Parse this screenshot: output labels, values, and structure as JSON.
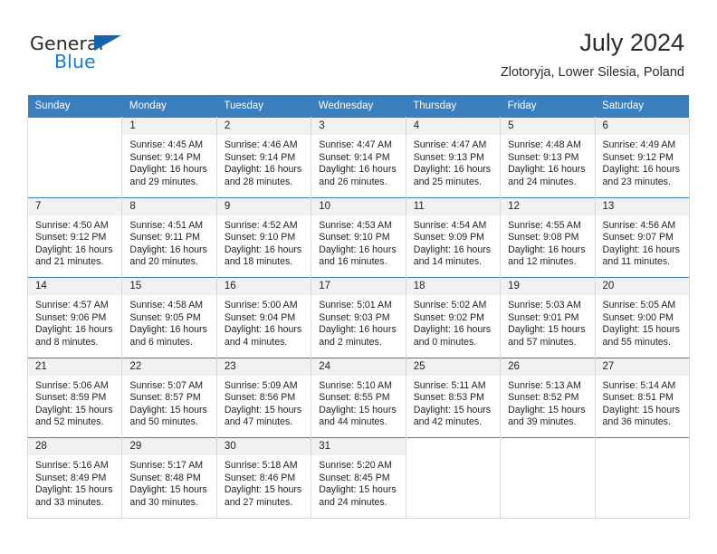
{
  "brand": {
    "name_dark": "General",
    "name_blue": "Blue",
    "accent_blue": "#1a7fd4",
    "triangle_blue": "#1464aa"
  },
  "header": {
    "title": "July 2024",
    "subtitle": "Zlotoryja, Lower Silesia, Poland"
  },
  "theme": {
    "header_row_bg": "#3a7ebe",
    "header_row_text": "#ffffff",
    "daynum_bg": "#f1f1f1",
    "cell_border": "#d8d8d8",
    "week_top_border": "#3a7ebe"
  },
  "weekdays": [
    "Sunday",
    "Monday",
    "Tuesday",
    "Wednesday",
    "Thursday",
    "Friday",
    "Saturday"
  ],
  "weeks": [
    [
      {
        "day": "",
        "sunrise": "",
        "sunset": "",
        "daylight1": "",
        "daylight2": ""
      },
      {
        "day": "1",
        "sunrise": "Sunrise: 4:45 AM",
        "sunset": "Sunset: 9:14 PM",
        "daylight1": "Daylight: 16 hours",
        "daylight2": "and 29 minutes."
      },
      {
        "day": "2",
        "sunrise": "Sunrise: 4:46 AM",
        "sunset": "Sunset: 9:14 PM",
        "daylight1": "Daylight: 16 hours",
        "daylight2": "and 28 minutes."
      },
      {
        "day": "3",
        "sunrise": "Sunrise: 4:47 AM",
        "sunset": "Sunset: 9:14 PM",
        "daylight1": "Daylight: 16 hours",
        "daylight2": "and 26 minutes."
      },
      {
        "day": "4",
        "sunrise": "Sunrise: 4:47 AM",
        "sunset": "Sunset: 9:13 PM",
        "daylight1": "Daylight: 16 hours",
        "daylight2": "and 25 minutes."
      },
      {
        "day": "5",
        "sunrise": "Sunrise: 4:48 AM",
        "sunset": "Sunset: 9:13 PM",
        "daylight1": "Daylight: 16 hours",
        "daylight2": "and 24 minutes."
      },
      {
        "day": "6",
        "sunrise": "Sunrise: 4:49 AM",
        "sunset": "Sunset: 9:12 PM",
        "daylight1": "Daylight: 16 hours",
        "daylight2": "and 23 minutes."
      }
    ],
    [
      {
        "day": "7",
        "sunrise": "Sunrise: 4:50 AM",
        "sunset": "Sunset: 9:12 PM",
        "daylight1": "Daylight: 16 hours",
        "daylight2": "and 21 minutes."
      },
      {
        "day": "8",
        "sunrise": "Sunrise: 4:51 AM",
        "sunset": "Sunset: 9:11 PM",
        "daylight1": "Daylight: 16 hours",
        "daylight2": "and 20 minutes."
      },
      {
        "day": "9",
        "sunrise": "Sunrise: 4:52 AM",
        "sunset": "Sunset: 9:10 PM",
        "daylight1": "Daylight: 16 hours",
        "daylight2": "and 18 minutes."
      },
      {
        "day": "10",
        "sunrise": "Sunrise: 4:53 AM",
        "sunset": "Sunset: 9:10 PM",
        "daylight1": "Daylight: 16 hours",
        "daylight2": "and 16 minutes."
      },
      {
        "day": "11",
        "sunrise": "Sunrise: 4:54 AM",
        "sunset": "Sunset: 9:09 PM",
        "daylight1": "Daylight: 16 hours",
        "daylight2": "and 14 minutes."
      },
      {
        "day": "12",
        "sunrise": "Sunrise: 4:55 AM",
        "sunset": "Sunset: 9:08 PM",
        "daylight1": "Daylight: 16 hours",
        "daylight2": "and 12 minutes."
      },
      {
        "day": "13",
        "sunrise": "Sunrise: 4:56 AM",
        "sunset": "Sunset: 9:07 PM",
        "daylight1": "Daylight: 16 hours",
        "daylight2": "and 11 minutes."
      }
    ],
    [
      {
        "day": "14",
        "sunrise": "Sunrise: 4:57 AM",
        "sunset": "Sunset: 9:06 PM",
        "daylight1": "Daylight: 16 hours",
        "daylight2": "and 8 minutes."
      },
      {
        "day": "15",
        "sunrise": "Sunrise: 4:58 AM",
        "sunset": "Sunset: 9:05 PM",
        "daylight1": "Daylight: 16 hours",
        "daylight2": "and 6 minutes."
      },
      {
        "day": "16",
        "sunrise": "Sunrise: 5:00 AM",
        "sunset": "Sunset: 9:04 PM",
        "daylight1": "Daylight: 16 hours",
        "daylight2": "and 4 minutes."
      },
      {
        "day": "17",
        "sunrise": "Sunrise: 5:01 AM",
        "sunset": "Sunset: 9:03 PM",
        "daylight1": "Daylight: 16 hours",
        "daylight2": "and 2 minutes."
      },
      {
        "day": "18",
        "sunrise": "Sunrise: 5:02 AM",
        "sunset": "Sunset: 9:02 PM",
        "daylight1": "Daylight: 16 hours",
        "daylight2": "and 0 minutes."
      },
      {
        "day": "19",
        "sunrise": "Sunrise: 5:03 AM",
        "sunset": "Sunset: 9:01 PM",
        "daylight1": "Daylight: 15 hours",
        "daylight2": "and 57 minutes."
      },
      {
        "day": "20",
        "sunrise": "Sunrise: 5:05 AM",
        "sunset": "Sunset: 9:00 PM",
        "daylight1": "Daylight: 15 hours",
        "daylight2": "and 55 minutes."
      }
    ],
    [
      {
        "day": "21",
        "sunrise": "Sunrise: 5:06 AM",
        "sunset": "Sunset: 8:59 PM",
        "daylight1": "Daylight: 15 hours",
        "daylight2": "and 52 minutes."
      },
      {
        "day": "22",
        "sunrise": "Sunrise: 5:07 AM",
        "sunset": "Sunset: 8:57 PM",
        "daylight1": "Daylight: 15 hours",
        "daylight2": "and 50 minutes."
      },
      {
        "day": "23",
        "sunrise": "Sunrise: 5:09 AM",
        "sunset": "Sunset: 8:56 PM",
        "daylight1": "Daylight: 15 hours",
        "daylight2": "and 47 minutes."
      },
      {
        "day": "24",
        "sunrise": "Sunrise: 5:10 AM",
        "sunset": "Sunset: 8:55 PM",
        "daylight1": "Daylight: 15 hours",
        "daylight2": "and 44 minutes."
      },
      {
        "day": "25",
        "sunrise": "Sunrise: 5:11 AM",
        "sunset": "Sunset: 8:53 PM",
        "daylight1": "Daylight: 15 hours",
        "daylight2": "and 42 minutes."
      },
      {
        "day": "26",
        "sunrise": "Sunrise: 5:13 AM",
        "sunset": "Sunset: 8:52 PM",
        "daylight1": "Daylight: 15 hours",
        "daylight2": "and 39 minutes."
      },
      {
        "day": "27",
        "sunrise": "Sunrise: 5:14 AM",
        "sunset": "Sunset: 8:51 PM",
        "daylight1": "Daylight: 15 hours",
        "daylight2": "and 36 minutes."
      }
    ],
    [
      {
        "day": "28",
        "sunrise": "Sunrise: 5:16 AM",
        "sunset": "Sunset: 8:49 PM",
        "daylight1": "Daylight: 15 hours",
        "daylight2": "and 33 minutes."
      },
      {
        "day": "29",
        "sunrise": "Sunrise: 5:17 AM",
        "sunset": "Sunset: 8:48 PM",
        "daylight1": "Daylight: 15 hours",
        "daylight2": "and 30 minutes."
      },
      {
        "day": "30",
        "sunrise": "Sunrise: 5:18 AM",
        "sunset": "Sunset: 8:46 PM",
        "daylight1": "Daylight: 15 hours",
        "daylight2": "and 27 minutes."
      },
      {
        "day": "31",
        "sunrise": "Sunrise: 5:20 AM",
        "sunset": "Sunset: 8:45 PM",
        "daylight1": "Daylight: 15 hours",
        "daylight2": "and 24 minutes."
      },
      {
        "day": "",
        "sunrise": "",
        "sunset": "",
        "daylight1": "",
        "daylight2": ""
      },
      {
        "day": "",
        "sunrise": "",
        "sunset": "",
        "daylight1": "",
        "daylight2": ""
      },
      {
        "day": "",
        "sunrise": "",
        "sunset": "",
        "daylight1": "",
        "daylight2": ""
      }
    ]
  ]
}
